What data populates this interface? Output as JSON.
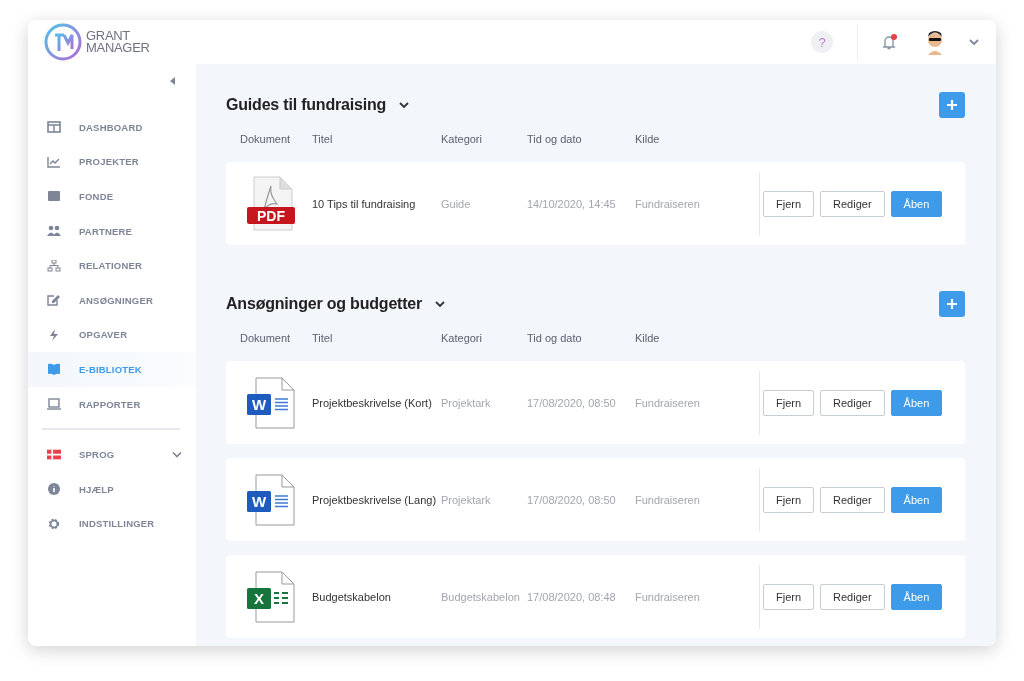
{
  "header": {
    "logo_line_1": "GRANT",
    "logo_line_2": "MANAGER",
    "help": "?",
    "notifications_unread": true
  },
  "sidebar": {
    "items": [
      {
        "label": "DASHBOARD",
        "selected": false
      },
      {
        "label": "PROJEKTER",
        "selected": false
      },
      {
        "label": "FONDE",
        "selected": false
      },
      {
        "label": "PARTNERE",
        "selected": false
      },
      {
        "label": "RELATIONER",
        "selected": false
      },
      {
        "label": "ANSØGNINGER",
        "selected": false
      },
      {
        "label": "OPGAVER",
        "selected": false
      },
      {
        "label": "E-BIBLIOTEK",
        "selected": true
      },
      {
        "label": "RAPPORTER",
        "selected": false
      }
    ],
    "bottom_items": [
      {
        "label": "SPROG",
        "kind": "language"
      },
      {
        "label": "HJÆLP",
        "kind": "help"
      },
      {
        "label": "INDSTILLINGER",
        "kind": "settings"
      }
    ]
  },
  "sections": [
    {
      "title": "Guides til fundraising",
      "columns": [
        "Dokument",
        "Titel",
        "Kategori",
        "Tid og dato",
        "Kilde"
      ],
      "rows": [
        {
          "kind": "pdf",
          "badge": "PDF",
          "title": "10 Tips til fundraising",
          "category": "Guide",
          "datetime": "14/10/2020, 14:45",
          "source": "Fundraiseren",
          "actions": [
            "Fjern",
            "Rediger",
            "Åben"
          ]
        }
      ]
    },
    {
      "title": "Ansøgninger og budgetter",
      "columns": [
        "Dokument",
        "Titel",
        "Kategori",
        "Tid og dato",
        "Kilde"
      ],
      "rows": [
        {
          "kind": "word",
          "badge": "W",
          "title": "Projektbeskrivelse (Kort)",
          "category": "Projektark",
          "datetime": "17/08/2020, 08:50",
          "source": "Fundraiseren",
          "actions": [
            "Fjern",
            "Rediger",
            "Åben"
          ]
        },
        {
          "kind": "word",
          "badge": "W",
          "title": "Projektbeskrivelse (Lang)",
          "category": "Projektark",
          "datetime": "17/08/2020, 08:50",
          "source": "Fundraiseren",
          "actions": [
            "Fjern",
            "Rediger",
            "Åben"
          ]
        },
        {
          "kind": "excel",
          "badge": "X",
          "title": "Budgetskabelon",
          "category": "Budgetskabelon",
          "datetime": "17/08/2020, 08:48",
          "source": "Fundraiseren",
          "actions": [
            "Fjern",
            "Rediger",
            "Åben"
          ]
        }
      ]
    }
  ]
}
